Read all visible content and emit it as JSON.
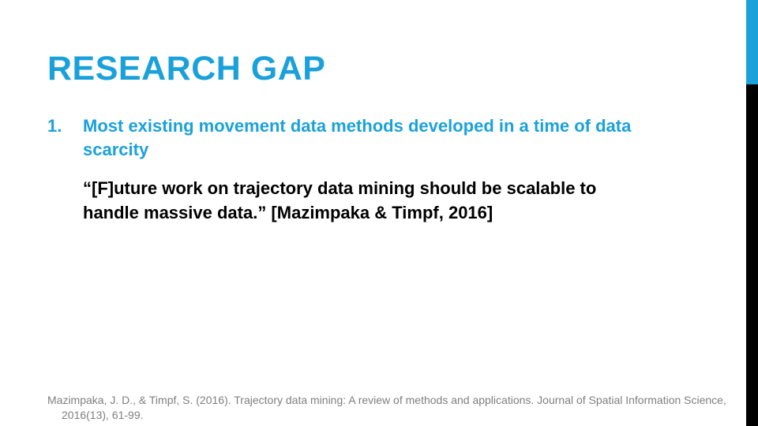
{
  "slide": {
    "title": "RESEARCH GAP",
    "point_number": "1.",
    "point_text": "Most existing movement data methods developed in a time of data scarcity",
    "quote": "“[F]uture work on trajectory data mining should be scalable to handle massive data.” [Mazimpaka & Timpf, 2016]",
    "reference": "Mazimpaka, J. D., & Timpf, S. (2016). Trajectory data mining: A review of methods and applications. Journal of Spatial Information Science, 2016(13), 61-99."
  },
  "colors": {
    "accent": "#1ba1da",
    "text": "#000000",
    "reference_text": "#7f7f7f",
    "sidebar_dark": "#000000"
  }
}
